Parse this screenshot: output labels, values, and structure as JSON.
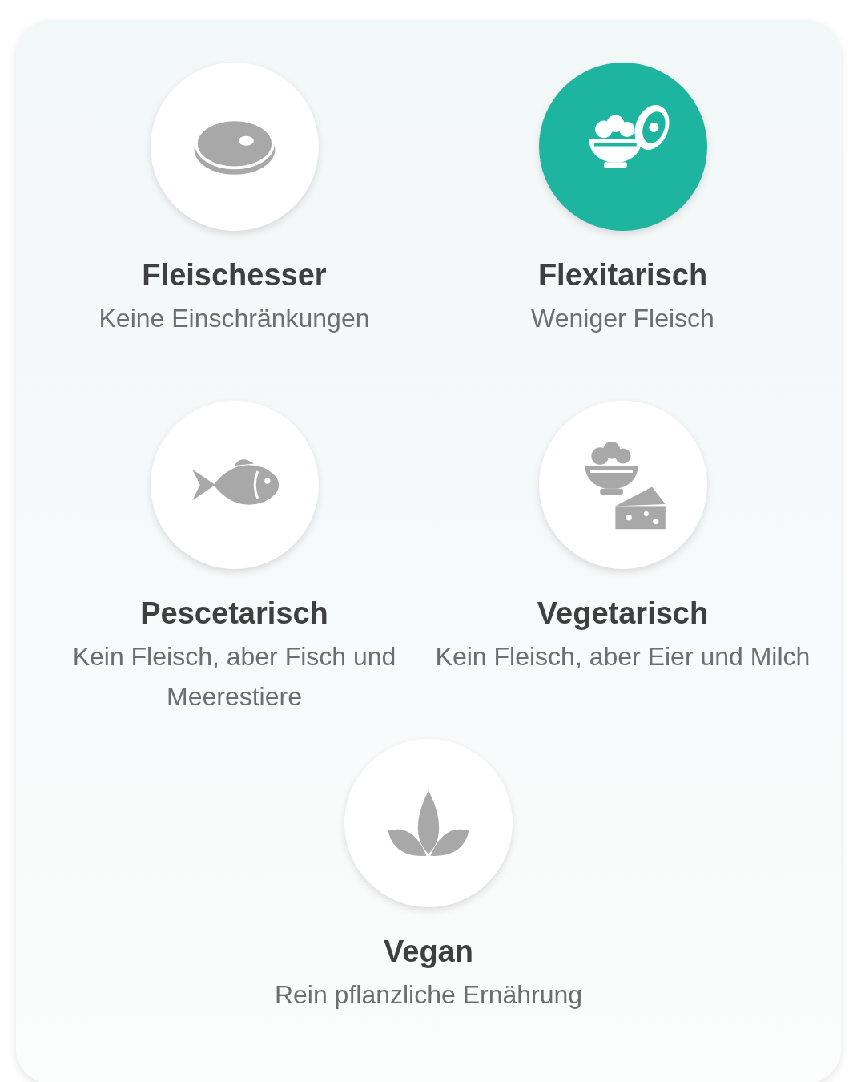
{
  "options": [
    {
      "kind": "meat",
      "title": "Fleischesser",
      "subtitle": "Keine Einschränkungen",
      "selected": false
    },
    {
      "kind": "flexitarian",
      "title": "Flexitarisch",
      "subtitle": "Weniger Fleisch",
      "selected": true
    },
    {
      "kind": "fish",
      "title": "Pescetarisch",
      "subtitle": "Kein Fleisch, aber Fisch und Meerestiere",
      "selected": false
    },
    {
      "kind": "vegetarian",
      "title": "Vegetarisch",
      "subtitle": "Kein Fleisch, aber Eier und Milch",
      "selected": false
    },
    {
      "kind": "vegan",
      "title": "Vegan",
      "subtitle": "Rein pflanzliche Ernährung",
      "selected": false
    }
  ]
}
